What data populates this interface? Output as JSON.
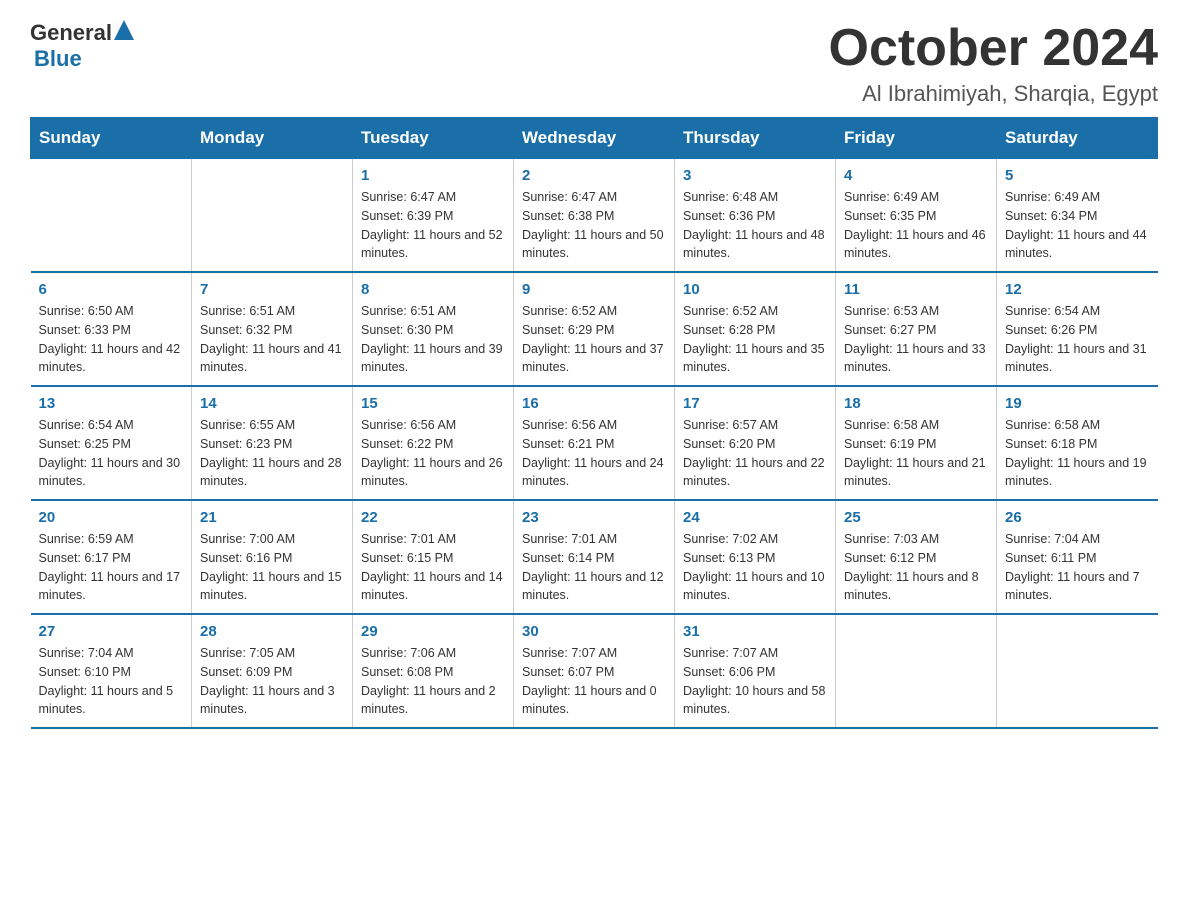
{
  "header": {
    "logo_general": "General",
    "logo_blue": "Blue",
    "title": "October 2024",
    "subtitle": "Al Ibrahimiyah, Sharqia, Egypt"
  },
  "days_of_week": [
    "Sunday",
    "Monday",
    "Tuesday",
    "Wednesday",
    "Thursday",
    "Friday",
    "Saturday"
  ],
  "weeks": [
    [
      {
        "number": "",
        "sunrise": "",
        "sunset": "",
        "daylight": ""
      },
      {
        "number": "",
        "sunrise": "",
        "sunset": "",
        "daylight": ""
      },
      {
        "number": "1",
        "sunrise": "Sunrise: 6:47 AM",
        "sunset": "Sunset: 6:39 PM",
        "daylight": "Daylight: 11 hours and 52 minutes."
      },
      {
        "number": "2",
        "sunrise": "Sunrise: 6:47 AM",
        "sunset": "Sunset: 6:38 PM",
        "daylight": "Daylight: 11 hours and 50 minutes."
      },
      {
        "number": "3",
        "sunrise": "Sunrise: 6:48 AM",
        "sunset": "Sunset: 6:36 PM",
        "daylight": "Daylight: 11 hours and 48 minutes."
      },
      {
        "number": "4",
        "sunrise": "Sunrise: 6:49 AM",
        "sunset": "Sunset: 6:35 PM",
        "daylight": "Daylight: 11 hours and 46 minutes."
      },
      {
        "number": "5",
        "sunrise": "Sunrise: 6:49 AM",
        "sunset": "Sunset: 6:34 PM",
        "daylight": "Daylight: 11 hours and 44 minutes."
      }
    ],
    [
      {
        "number": "6",
        "sunrise": "Sunrise: 6:50 AM",
        "sunset": "Sunset: 6:33 PM",
        "daylight": "Daylight: 11 hours and 42 minutes."
      },
      {
        "number": "7",
        "sunrise": "Sunrise: 6:51 AM",
        "sunset": "Sunset: 6:32 PM",
        "daylight": "Daylight: 11 hours and 41 minutes."
      },
      {
        "number": "8",
        "sunrise": "Sunrise: 6:51 AM",
        "sunset": "Sunset: 6:30 PM",
        "daylight": "Daylight: 11 hours and 39 minutes."
      },
      {
        "number": "9",
        "sunrise": "Sunrise: 6:52 AM",
        "sunset": "Sunset: 6:29 PM",
        "daylight": "Daylight: 11 hours and 37 minutes."
      },
      {
        "number": "10",
        "sunrise": "Sunrise: 6:52 AM",
        "sunset": "Sunset: 6:28 PM",
        "daylight": "Daylight: 11 hours and 35 minutes."
      },
      {
        "number": "11",
        "sunrise": "Sunrise: 6:53 AM",
        "sunset": "Sunset: 6:27 PM",
        "daylight": "Daylight: 11 hours and 33 minutes."
      },
      {
        "number": "12",
        "sunrise": "Sunrise: 6:54 AM",
        "sunset": "Sunset: 6:26 PM",
        "daylight": "Daylight: 11 hours and 31 minutes."
      }
    ],
    [
      {
        "number": "13",
        "sunrise": "Sunrise: 6:54 AM",
        "sunset": "Sunset: 6:25 PM",
        "daylight": "Daylight: 11 hours and 30 minutes."
      },
      {
        "number": "14",
        "sunrise": "Sunrise: 6:55 AM",
        "sunset": "Sunset: 6:23 PM",
        "daylight": "Daylight: 11 hours and 28 minutes."
      },
      {
        "number": "15",
        "sunrise": "Sunrise: 6:56 AM",
        "sunset": "Sunset: 6:22 PM",
        "daylight": "Daylight: 11 hours and 26 minutes."
      },
      {
        "number": "16",
        "sunrise": "Sunrise: 6:56 AM",
        "sunset": "Sunset: 6:21 PM",
        "daylight": "Daylight: 11 hours and 24 minutes."
      },
      {
        "number": "17",
        "sunrise": "Sunrise: 6:57 AM",
        "sunset": "Sunset: 6:20 PM",
        "daylight": "Daylight: 11 hours and 22 minutes."
      },
      {
        "number": "18",
        "sunrise": "Sunrise: 6:58 AM",
        "sunset": "Sunset: 6:19 PM",
        "daylight": "Daylight: 11 hours and 21 minutes."
      },
      {
        "number": "19",
        "sunrise": "Sunrise: 6:58 AM",
        "sunset": "Sunset: 6:18 PM",
        "daylight": "Daylight: 11 hours and 19 minutes."
      }
    ],
    [
      {
        "number": "20",
        "sunrise": "Sunrise: 6:59 AM",
        "sunset": "Sunset: 6:17 PM",
        "daylight": "Daylight: 11 hours and 17 minutes."
      },
      {
        "number": "21",
        "sunrise": "Sunrise: 7:00 AM",
        "sunset": "Sunset: 6:16 PM",
        "daylight": "Daylight: 11 hours and 15 minutes."
      },
      {
        "number": "22",
        "sunrise": "Sunrise: 7:01 AM",
        "sunset": "Sunset: 6:15 PM",
        "daylight": "Daylight: 11 hours and 14 minutes."
      },
      {
        "number": "23",
        "sunrise": "Sunrise: 7:01 AM",
        "sunset": "Sunset: 6:14 PM",
        "daylight": "Daylight: 11 hours and 12 minutes."
      },
      {
        "number": "24",
        "sunrise": "Sunrise: 7:02 AM",
        "sunset": "Sunset: 6:13 PM",
        "daylight": "Daylight: 11 hours and 10 minutes."
      },
      {
        "number": "25",
        "sunrise": "Sunrise: 7:03 AM",
        "sunset": "Sunset: 6:12 PM",
        "daylight": "Daylight: 11 hours and 8 minutes."
      },
      {
        "number": "26",
        "sunrise": "Sunrise: 7:04 AM",
        "sunset": "Sunset: 6:11 PM",
        "daylight": "Daylight: 11 hours and 7 minutes."
      }
    ],
    [
      {
        "number": "27",
        "sunrise": "Sunrise: 7:04 AM",
        "sunset": "Sunset: 6:10 PM",
        "daylight": "Daylight: 11 hours and 5 minutes."
      },
      {
        "number": "28",
        "sunrise": "Sunrise: 7:05 AM",
        "sunset": "Sunset: 6:09 PM",
        "daylight": "Daylight: 11 hours and 3 minutes."
      },
      {
        "number": "29",
        "sunrise": "Sunrise: 7:06 AM",
        "sunset": "Sunset: 6:08 PM",
        "daylight": "Daylight: 11 hours and 2 minutes."
      },
      {
        "number": "30",
        "sunrise": "Sunrise: 7:07 AM",
        "sunset": "Sunset: 6:07 PM",
        "daylight": "Daylight: 11 hours and 0 minutes."
      },
      {
        "number": "31",
        "sunrise": "Sunrise: 7:07 AM",
        "sunset": "Sunset: 6:06 PM",
        "daylight": "Daylight: 10 hours and 58 minutes."
      },
      {
        "number": "",
        "sunrise": "",
        "sunset": "",
        "daylight": ""
      },
      {
        "number": "",
        "sunrise": "",
        "sunset": "",
        "daylight": ""
      }
    ]
  ]
}
